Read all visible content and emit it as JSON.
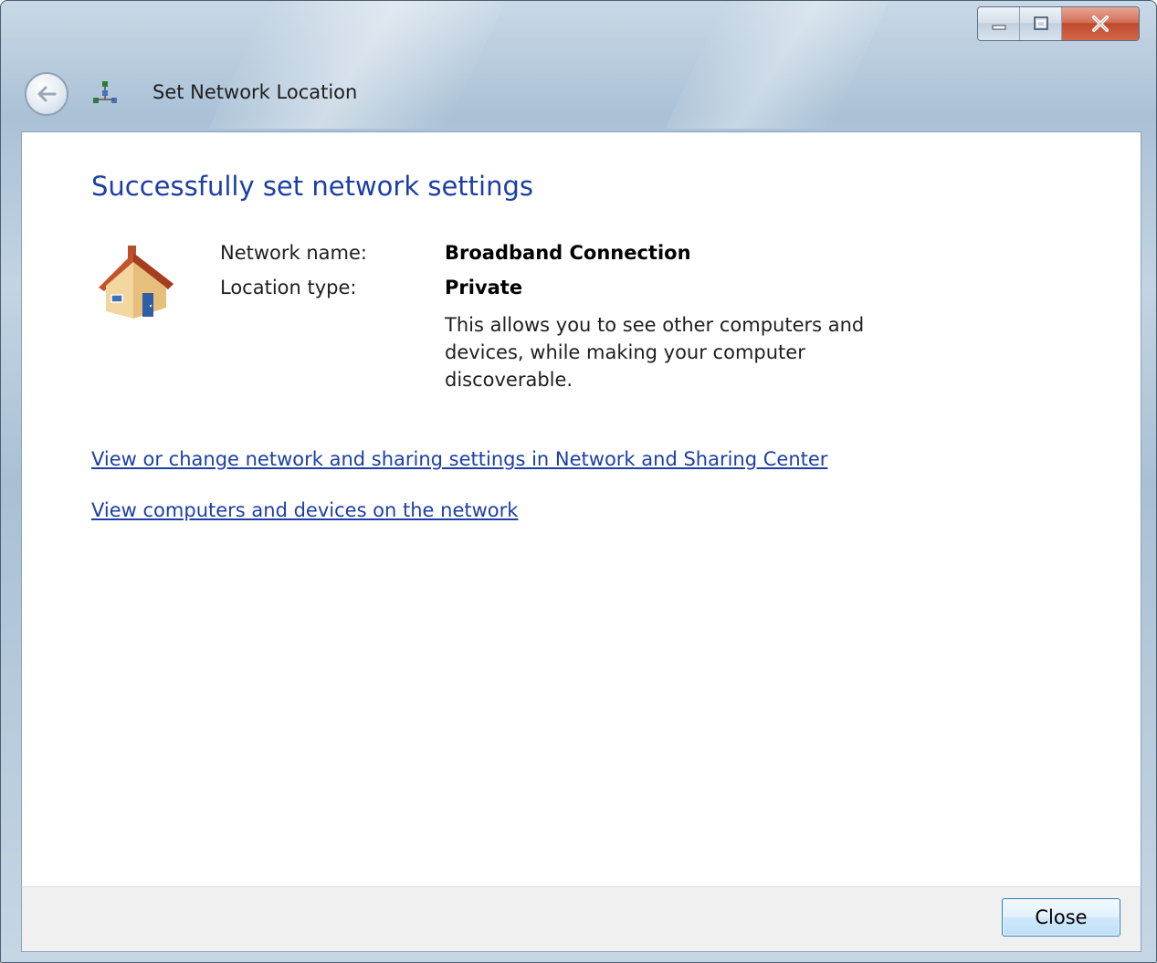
{
  "window": {
    "title": "Set Network Location",
    "buttons": {
      "minimize": "minimize-icon",
      "maximize": "maximize-icon",
      "close": "close-icon"
    },
    "back_icon": "back-arrow-icon",
    "app_icon": "network-icon"
  },
  "content": {
    "heading": "Successfully set network settings",
    "icon": "house-icon",
    "fields": [
      {
        "label": "Network name:",
        "value": "Broadband Connection"
      },
      {
        "label": "Location type:",
        "value": "Private"
      }
    ],
    "description": "This allows you to see other computers and devices, while making your computer discoverable.",
    "links": [
      "View or change network and sharing settings in Network and Sharing Center",
      "View computers and devices on the network"
    ]
  },
  "footer": {
    "close_label": "Close"
  },
  "colors": {
    "heading": "#1d3fa4",
    "link": "#1d3fa4",
    "glass": "#aac1d6"
  }
}
